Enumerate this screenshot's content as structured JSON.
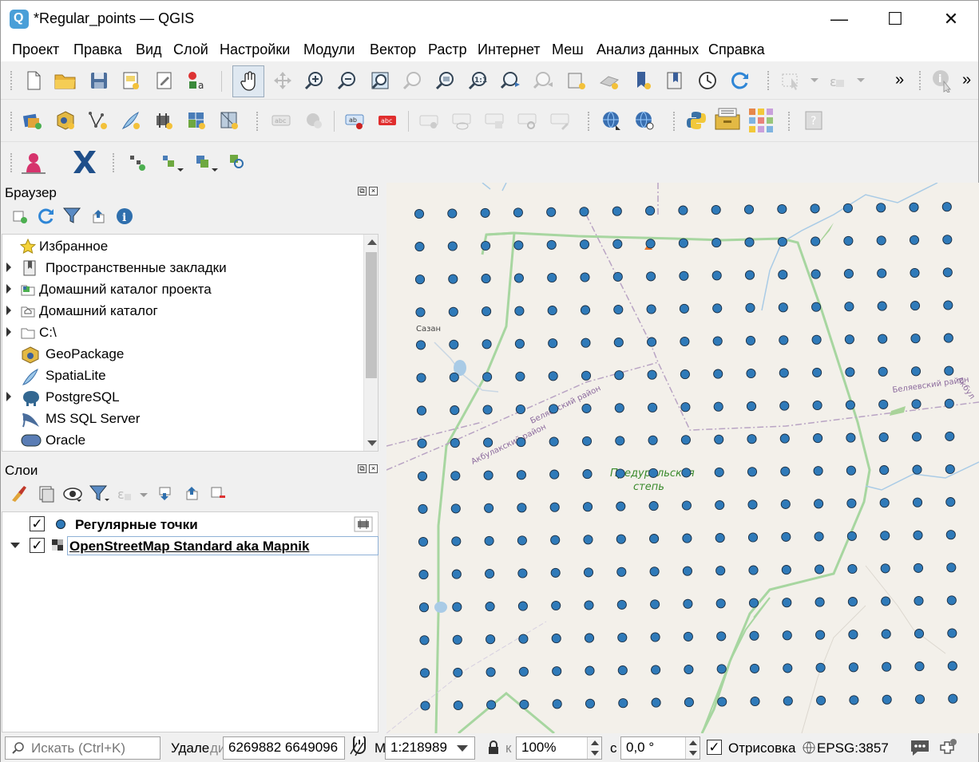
{
  "window": {
    "title": "*Regular_points — QGIS",
    "minimize": "—",
    "maximize": "☐",
    "close": "✕"
  },
  "menu": [
    "Проект",
    "Правка",
    "Вид",
    "Слой",
    "Настройки",
    "Модули",
    "Вектор",
    "Растр",
    "Интернет",
    "Меш",
    "Анализ данных",
    "Справка"
  ],
  "toolbar": {
    "overflow": "»"
  },
  "browser": {
    "title": "Браузер",
    "items": [
      {
        "label": "Избранное",
        "icon": "star-icon",
        "expandable": false
      },
      {
        "label": "Пространственные закладки",
        "icon": "bookmark-icon",
        "expandable": true
      },
      {
        "label": "Домашний каталог проекта",
        "icon": "project-home-icon",
        "expandable": true
      },
      {
        "label": "Домашний каталог",
        "icon": "home-folder-icon",
        "expandable": true
      },
      {
        "label": "C:\\",
        "icon": "drive-icon",
        "expandable": true
      },
      {
        "label": "GeoPackage",
        "icon": "geopackage-icon",
        "expandable": false
      },
      {
        "label": "SpatiaLite",
        "icon": "spatialite-icon",
        "expandable": false
      },
      {
        "label": "PostgreSQL",
        "icon": "postgresql-icon",
        "expandable": true
      },
      {
        "label": "MS SQL Server",
        "icon": "mssql-icon",
        "expandable": false
      },
      {
        "label": "Oracle",
        "icon": "oracle-icon",
        "expandable": false
      }
    ]
  },
  "layers": {
    "title": "Слои",
    "items": [
      {
        "label": "Регулярные точки",
        "checked": true,
        "bold": true
      },
      {
        "label": "OpenStreetMap Standard aka Mapnik",
        "checked": true,
        "selected": true
      }
    ]
  },
  "map": {
    "labels": {
      "town": "Сазан",
      "region1": "Беляевский район",
      "region2": "Акбулакский район",
      "region3": "Беляевский район",
      "region4": "Акбул",
      "steppe1": "Предуральская",
      "steppe2": "степь"
    },
    "point_color": "#2f7ab9"
  },
  "status": {
    "search_placeholder": "Искать (Ctrl+K)",
    "coord_label": "Удале",
    "coord_label2": "ди",
    "coordinate": "6269882 6649096",
    "scale_label": "М",
    "scale": "1:218989",
    "mag_label": "к",
    "magnifier": "100%",
    "rotation_label": "с",
    "rotation": "0,0 °",
    "render_label": "Отрисовка",
    "render_checked": "✓",
    "crs": "EPSG:3857"
  }
}
